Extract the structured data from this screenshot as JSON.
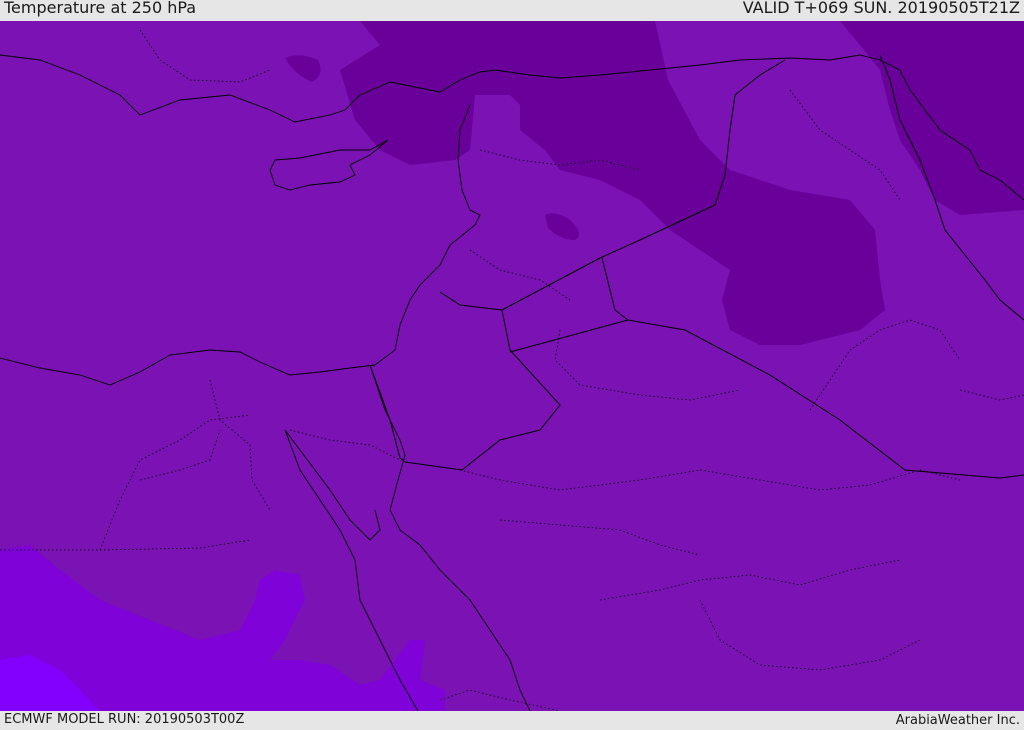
{
  "header": {
    "title": "Temperature at 250 hPa",
    "valid": "VALID T+069 SUN. 20190505T21Z"
  },
  "footer": {
    "model_run": "ECMWF MODEL RUN: 20190503T00Z",
    "credit": "ArabiaWeather Inc."
  },
  "map": {
    "colors": {
      "base": "#7a12b4",
      "cold": "#680099",
      "warm": "#7f02d8",
      "warmest": "#8300ff",
      "border": "#000000"
    }
  }
}
